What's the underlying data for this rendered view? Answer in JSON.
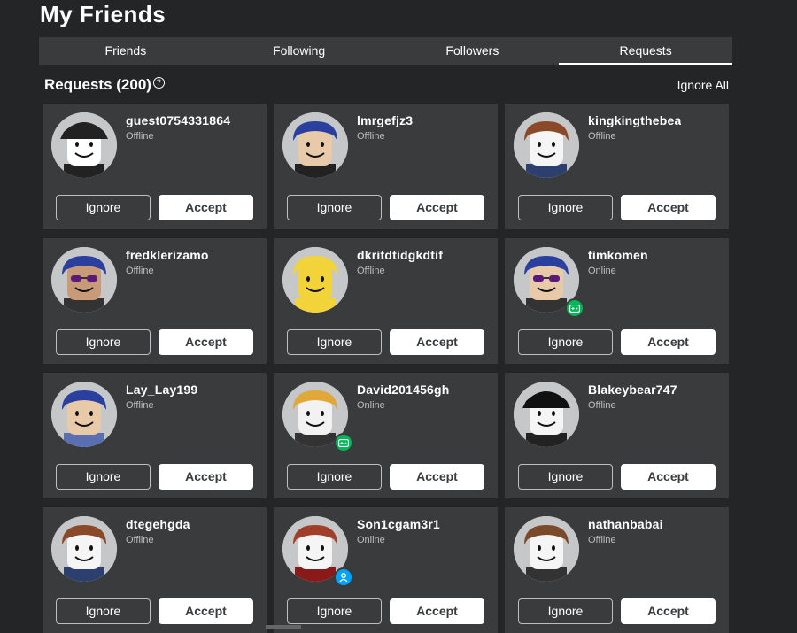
{
  "page": {
    "title": "My Friends"
  },
  "tabs": [
    {
      "label": "Friends",
      "active": false
    },
    {
      "label": "Following",
      "active": false
    },
    {
      "label": "Followers",
      "active": false
    },
    {
      "label": "Requests",
      "active": true
    }
  ],
  "requests": {
    "title": "Requests (200)",
    "help_icon": "?",
    "ignore_all_label": "Ignore All",
    "ignore_label": "Ignore",
    "accept_label": "Accept",
    "items": [
      {
        "username": "guest0754331864",
        "status": "Offline",
        "presence": null
      },
      {
        "username": "lmrgefjz3",
        "status": "Offline",
        "presence": null
      },
      {
        "username": "kingkingthebea",
        "status": "Offline",
        "presence": null
      },
      {
        "username": "fredklerizamo",
        "status": "Offline",
        "presence": null
      },
      {
        "username": "dkritdtidgkdtif",
        "status": "Offline",
        "presence": null
      },
      {
        "username": "timkomen",
        "status": "Online",
        "presence": "in-game"
      },
      {
        "username": "Lay_Lay199",
        "status": "Offline",
        "presence": null
      },
      {
        "username": "David201456gh",
        "status": "Online",
        "presence": "in-game"
      },
      {
        "username": "Blakeybear747",
        "status": "Offline",
        "presence": null
      },
      {
        "username": "dtegehgda",
        "status": "Offline",
        "presence": null
      },
      {
        "username": "Son1cgam3r1",
        "status": "Online",
        "presence": "online"
      },
      {
        "username": "nathanbabai",
        "status": "Offline",
        "presence": null
      }
    ]
  },
  "colors": {
    "background": "#232527",
    "card": "#393b3d",
    "in_game": "#02b757",
    "online_badge": "#00a2ff"
  }
}
